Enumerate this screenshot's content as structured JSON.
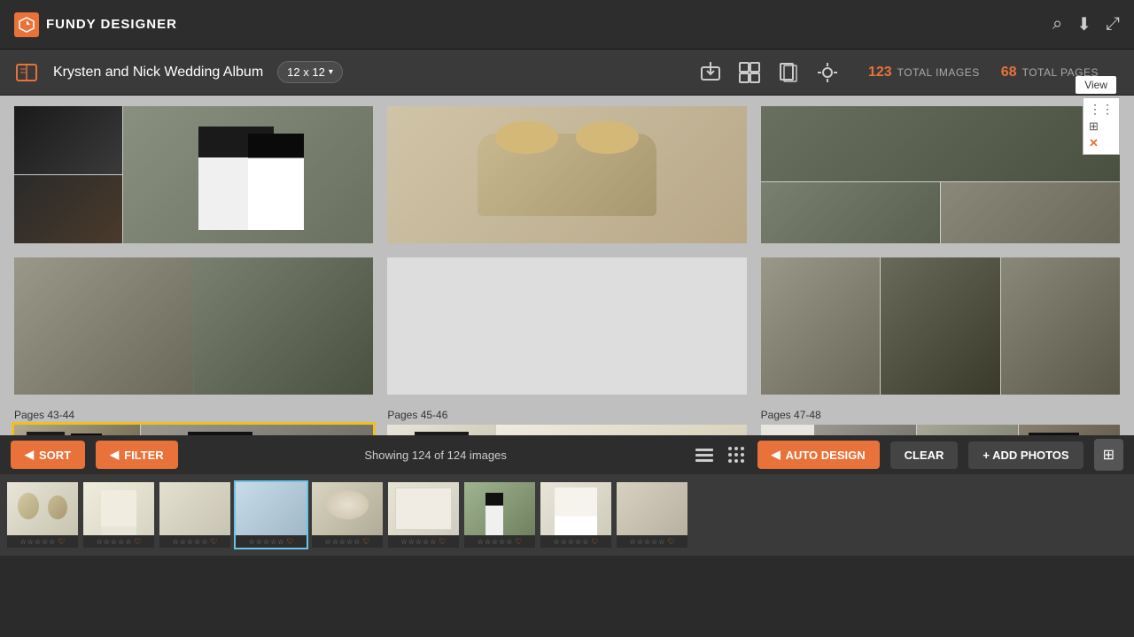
{
  "app": {
    "name": "FUNDY DESIGNER"
  },
  "header": {
    "title": "Fundy Designer",
    "icons": [
      "search-zoom",
      "download",
      "external-link"
    ]
  },
  "toolbar": {
    "album_title": "Krysten and Nick Wedding Album",
    "album_size": "12 x 12",
    "total_images": "123",
    "total_images_label": "TOTAL IMAGES",
    "total_pages": "68",
    "total_pages_label": "TOTAL PAGES"
  },
  "pages": [
    {
      "label": "Pages 43-44",
      "selected": true
    },
    {
      "label": "Pages 45-46",
      "selected": false
    },
    {
      "label": "Pages 47-48",
      "selected": false
    }
  ],
  "view_button": {
    "label": "View"
  },
  "bottom_controls": {
    "sort_label": "SORT",
    "filter_label": "FILTER",
    "showing_text": "Showing 124 of 124 images",
    "auto_design_label": "AUTO DESIGN",
    "clear_label": "CLEAR",
    "add_photos_label": "+ ADD PHOTOS"
  },
  "strip_images": [
    {
      "id": 1,
      "selected": false
    },
    {
      "id": 2,
      "selected": false
    },
    {
      "id": 3,
      "selected": false
    },
    {
      "id": 4,
      "selected": true
    },
    {
      "id": 5,
      "selected": false
    },
    {
      "id": 6,
      "selected": false
    },
    {
      "id": 7,
      "selected": false
    },
    {
      "id": 8,
      "selected": false
    },
    {
      "id": 9,
      "selected": false
    }
  ],
  "colors": {
    "accent": "#e8723a",
    "header_bg": "#2d2d2d",
    "toolbar_bg": "#3a3a3a",
    "content_bg": "#c0c0c0",
    "selected_border": "#f0c020"
  }
}
